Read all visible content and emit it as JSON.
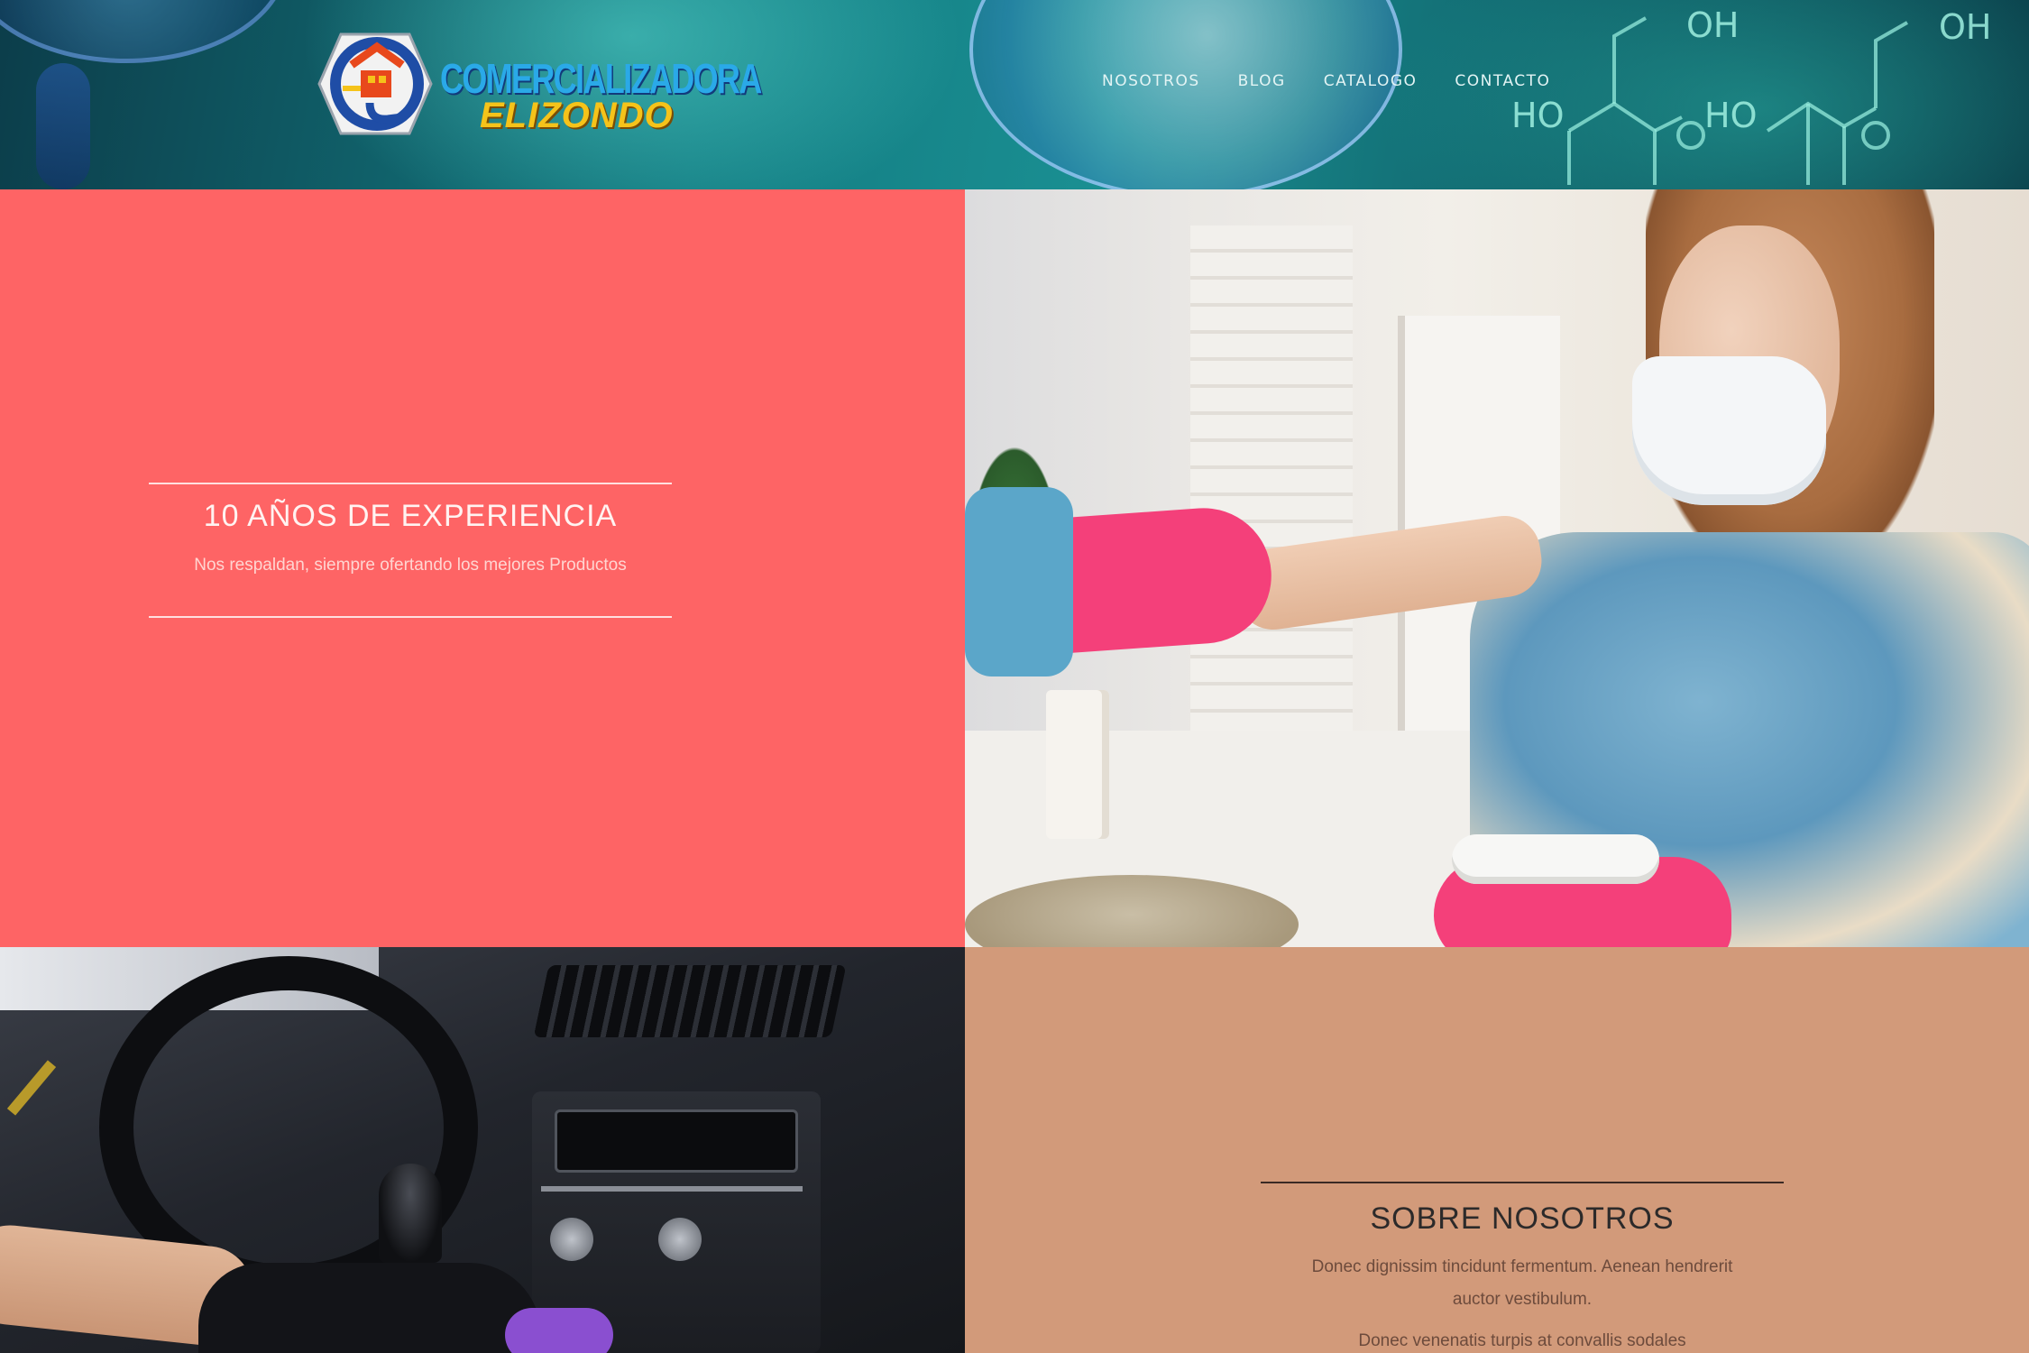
{
  "brand": {
    "name_line1": "COMERCIALIZADORA",
    "name_line2": "ELIZONDO",
    "colors": {
      "blue": "#2aa9e8",
      "yellow": "#f5c31a",
      "red_tile": "#fe6465",
      "tan_tile": "#d29a7a"
    }
  },
  "nav": {
    "items": [
      "NOSOTROS",
      "BLOG",
      "CATALOGO",
      "CONTACTO"
    ]
  },
  "header_decor": {
    "chem_labels": [
      "OH",
      "OH",
      "HO",
      "HO"
    ]
  },
  "feature": {
    "title": "10 AÑOS DE EXPERIENCIA",
    "text": "Nos respaldan, siempre ofertando los mejores Productos"
  },
  "about": {
    "title": "SOBRE NOSOTROS",
    "text1": "Donec dignissim tincidunt fermentum. Aenean hendrerit auctor vestibulum.",
    "text2": "Donec venenatis turpis at convallis sodales"
  },
  "images": {
    "photo1": "girl-cleaning-with-mask-and-pink-gloves",
    "photo2": "car-interior-cleaning-black-glove"
  }
}
